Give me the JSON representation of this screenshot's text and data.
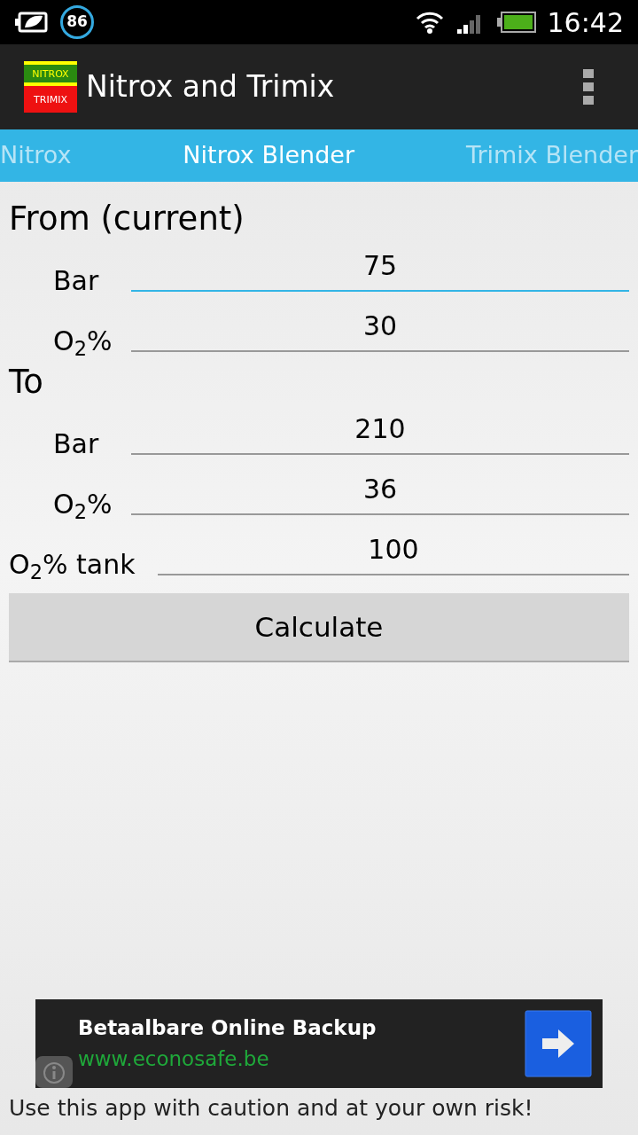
{
  "status_bar": {
    "notification_count": "86",
    "time": "16:42"
  },
  "action_bar": {
    "logo": [
      "NITROX",
      "TRIMIX"
    ],
    "title": "Nitrox and Trimix"
  },
  "tabs": [
    {
      "label": "Nitrox",
      "selected": false
    },
    {
      "label": "Nitrox Blender",
      "selected": true
    },
    {
      "label": "Trimix Blender",
      "selected": false
    }
  ],
  "sections": [
    {
      "heading": "From (current)",
      "fields": [
        {
          "label": "Bar",
          "value": "75",
          "focused": true,
          "kind": "indented"
        },
        {
          "label": "O$_{2}$%",
          "value": "30",
          "focused": false,
          "kind": "indented"
        }
      ]
    },
    {
      "heading": "To",
      "fields": [
        {
          "label": "Bar",
          "value": "210",
          "focused": false,
          "kind": "indented"
        },
        {
          "label": "O$_{2}$%",
          "value": "36",
          "focused": false,
          "kind": "indented"
        },
        {
          "label": "O$_{2}$% tank",
          "value": "100",
          "focused": false,
          "kind": "flush"
        }
      ]
    }
  ],
  "button": "Calculate",
  "ad": {
    "title": "Betaalbare Online Backup",
    "url": "www.econosafe.be"
  },
  "footer": "Use this app with caution and at your own risk!"
}
